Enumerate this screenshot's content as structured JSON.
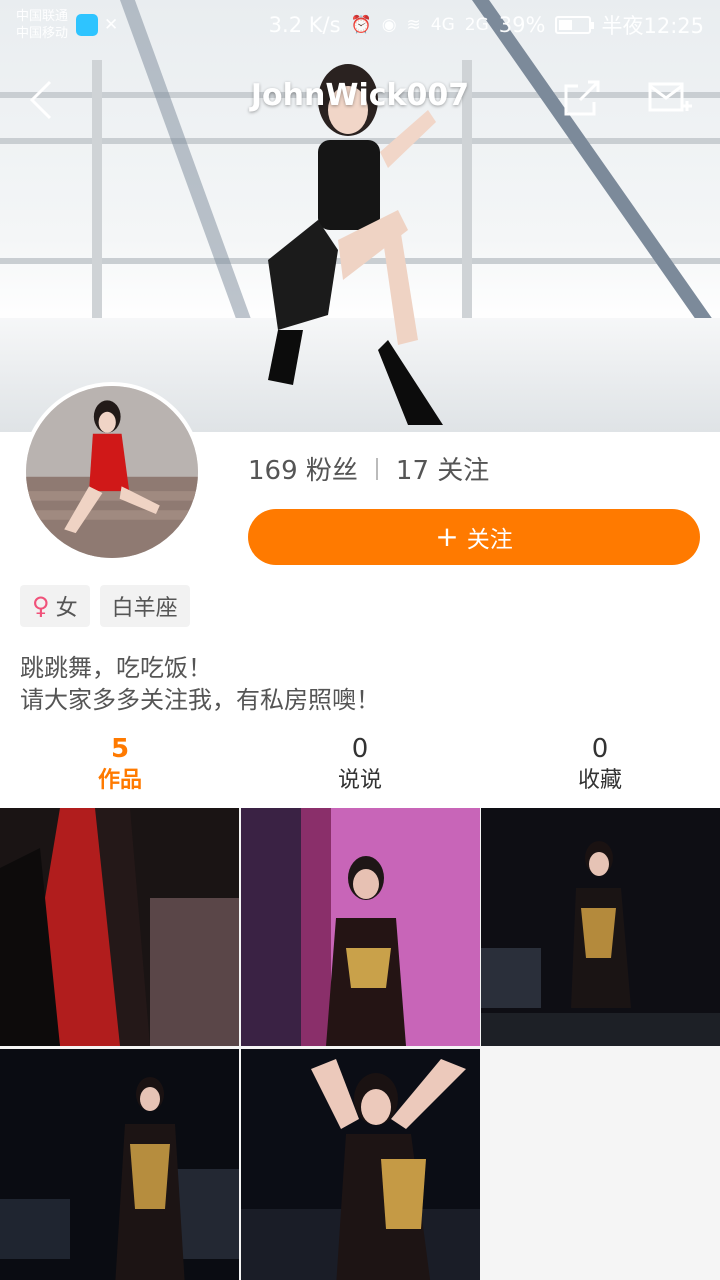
{
  "status": {
    "carrier1": "中国联通",
    "carrier2": "中国移动",
    "speed": "3.2 K/s",
    "net1": "4G",
    "net2": "2G",
    "battery": "39%",
    "time": "半夜12:25",
    "battery_level": 0.39
  },
  "header": {
    "title": "JohnWick007"
  },
  "profile": {
    "fans": "169 粉丝",
    "following": "17 关注",
    "follow_label": "关注",
    "gender": "女",
    "zodiac": "白羊座",
    "bio_line1": "跳跳舞，吃吃饭！",
    "bio_line2": "请大家多多关注我，有私房照噢！"
  },
  "tabs": [
    {
      "count": "5",
      "label": "作品"
    },
    {
      "count": "0",
      "label": "说说"
    },
    {
      "count": "0",
      "label": "收藏"
    }
  ],
  "colors": {
    "accent": "#ff7a00",
    "gender": "#f0527a"
  },
  "icons": [
    "back-arrow-icon",
    "share-icon",
    "message-add-icon",
    "female-icon",
    "plus-icon"
  ]
}
